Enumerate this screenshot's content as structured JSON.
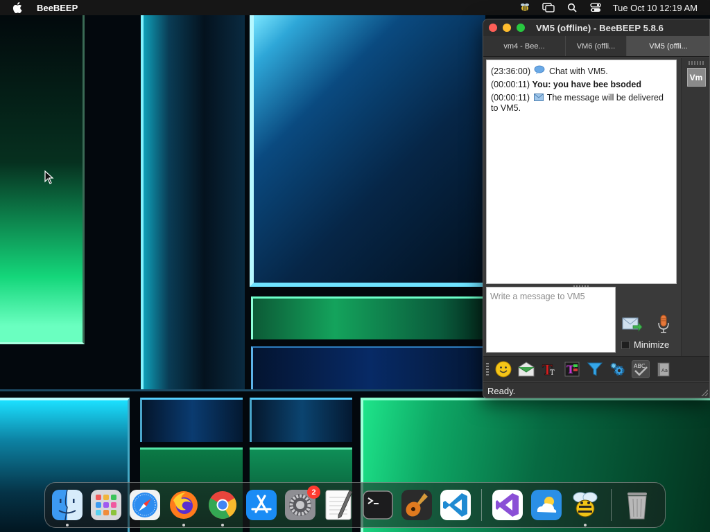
{
  "menubar": {
    "app_name": "BeeBEEP",
    "clock": "Tue Oct 10  12:19 AM"
  },
  "window": {
    "title": "VM5 (offline) - BeeBEEP 5.8.6",
    "tabs": [
      {
        "label": "vm4 - Bee..."
      },
      {
        "label": "VM6 (offli..."
      },
      {
        "label": "VM5 (offli..."
      }
    ],
    "chat": {
      "messages": [
        {
          "time": "(23:36:00)",
          "text": "Chat with VM5."
        },
        {
          "time": "(00:00:11)",
          "sender": "You:",
          "text": " you have bee bsoded"
        },
        {
          "time": "(00:00:11)",
          "text": "The message will be delivered to VM5."
        }
      ]
    },
    "avatar_label": "Vm",
    "input_placeholder": "Write a message to VM5",
    "minimize_label": "Minimize",
    "status": "Ready."
  },
  "dock": {
    "settings_badge": "2"
  },
  "icons": {
    "toolbar": [
      "emoji-icon",
      "mail-icon",
      "text-format-icon",
      "color-icon",
      "filter-icon",
      "settings-gear-icon",
      "spellcheck-icon",
      "dictionary-icon"
    ]
  }
}
